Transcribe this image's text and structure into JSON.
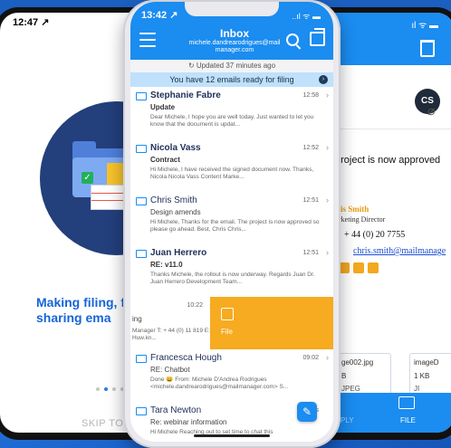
{
  "left_phone": {
    "time": "12:47 ↗",
    "headline": "Making filing, find and sharing ema",
    "skip": "SKIP TO LO"
  },
  "right_phone": {
    "avatar": "CS",
    "subject_text": "project is now approved",
    "sig_name": "ris Smith",
    "sig_title": "rketing Director",
    "sig_phone": "+ 44 (0) 20 7755",
    "sig_email": "chris.smith@mailmanage",
    "attachments": [
      {
        "name": "ge002.jpg",
        "size": "B",
        "type": "JPEG"
      },
      {
        "name": "imageD",
        "size": "1 KB",
        "type": "JI"
      }
    ],
    "reply_label": "PLY",
    "file_label": "FILE"
  },
  "center_phone": {
    "status": {
      "time": "13:42 ↗",
      "icons": "..ıl ᯤ ▬"
    },
    "header": {
      "title": "Inbox",
      "account": "michele.dandrearodrigues@mail manager.com"
    },
    "updated": "↻ Updated 37 minutes ago",
    "banner": "You have 12 emails ready for filing",
    "emails": [
      {
        "sender": "Stephanie Fabre",
        "time": "12:58",
        "subject": "Update",
        "preview": "Dear Michele,  I hope you are well today.  Just wanted to let you know that the document is updat...",
        "unread": true
      },
      {
        "sender": "Nicola Vass",
        "time": "12:52",
        "subject": "Contract",
        "preview": "Hi Michele,  I have received the signed document now.  Thanks, Nicola     Nicola Vass Content Marke...",
        "unread": true
      },
      {
        "sender": "Chris Smith",
        "time": "12:51",
        "subject": "Design amends",
        "preview": "Hi Michele,  Thanks for the email. The project is now approved so please go ahead.  Best, Chris     Chris...",
        "unread": false
      },
      {
        "sender": "Juan Herrero",
        "time": "12:51",
        "subject": "RE: v11.0",
        "preview": "Thanks Michele, the rollout is now underway. Regards Juan  Dr. Juan Herrero Development Team...",
        "unread": true
      }
    ],
    "swiped_email": {
      "time": "10:22",
      "subject": "ing",
      "preview": "Manager T: + 44 (0) 11 819 E:  Huw.kn...",
      "action": "File"
    },
    "emails_after": [
      {
        "sender": "Francesca Hough",
        "time": "09:02",
        "subject": "RE: Chatbot",
        "preview": "Done 😄  From: Michele D'Andrea Rodrigues <michele.dandrearodrigues@mailmanager.com> S...",
        "unread": false
      },
      {
        "sender": "Tara Newton",
        "time": "Yes",
        "subject": "Re: webinar information",
        "preview": "Hi Michele  Reaching out to set time to chat this",
        "unread": false
      }
    ]
  }
}
